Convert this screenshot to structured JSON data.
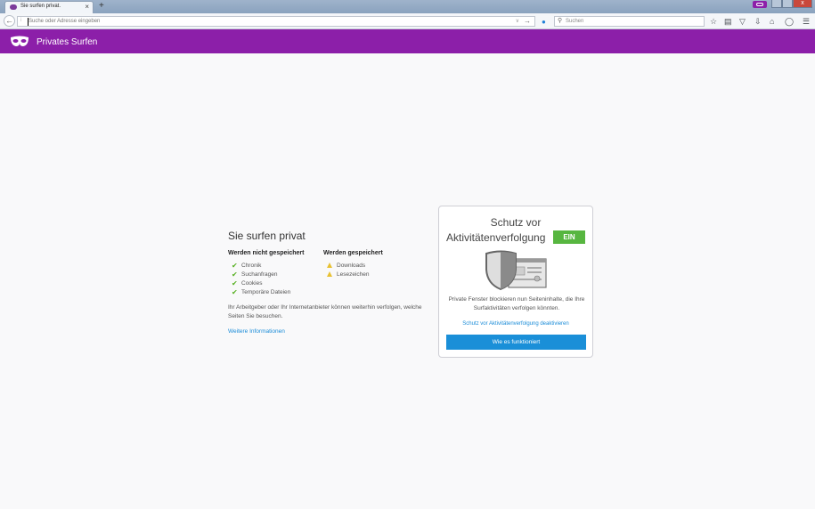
{
  "browser": {
    "tab": {
      "title": "Sie surfen privat.",
      "close": "×"
    },
    "new_tab": "+",
    "url": {
      "placeholder": "Suche oder Adresse eingeben",
      "info_icon": "i",
      "dropdown": "∨",
      "go": "→"
    },
    "search": {
      "placeholder": "Suchen",
      "engine_icon": "search-engine-icon"
    },
    "toolbar_icons": [
      "star-icon",
      "clipboard-icon",
      "pocket-icon",
      "download-icon",
      "home-icon",
      "chat-icon",
      "menu-icon"
    ],
    "window": {
      "close": "x"
    }
  },
  "header": {
    "title": "Privates Surfen"
  },
  "main": {
    "title": "Sie surfen privat",
    "not_saved": {
      "title": "Werden nicht gespeichert",
      "items": [
        "Chronik",
        "Suchanfragen",
        "Cookies",
        "Temporäre Dateien"
      ]
    },
    "saved": {
      "title": "Werden gespeichert",
      "items": [
        "Downloads",
        "Lesezeichen"
      ]
    },
    "note": "Ihr Arbeitgeber oder Ihr Internetanbieter können weiterhin verfolgen, welche Seiten Sie besuchen.",
    "more_link": "Weitere Informationen"
  },
  "tracking": {
    "title_line1": "Schutz vor",
    "title_line2": "Aktivitätenverfolgung",
    "status": "EIN",
    "description": "Private Fenster blockieren nun Seiteninhalte, die Ihre Surfaktivitäten verfolgen könnten.",
    "deactivate_link": "Schutz vor Aktivitätenverfolgung deaktivieren",
    "button": "Wie es funktioniert"
  },
  "colors": {
    "private_purple": "#8c1fa9",
    "accent_blue": "#1a8fd8",
    "on_green": "#57b640"
  }
}
